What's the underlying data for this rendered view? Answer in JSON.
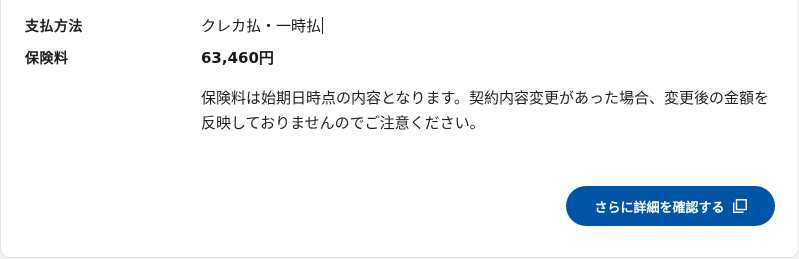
{
  "rows": {
    "payment_method": {
      "label": "支払方法",
      "value": "クレカ払・一時払"
    },
    "premium": {
      "label": "保険料",
      "value": "63,460円"
    }
  },
  "note": "保険料は始期日時点の内容となります。契約内容変更があった場合、変更後の金額を反映しておりませんのでご注意ください。",
  "details_button": {
    "label": "さらに詳細を確認する",
    "icon": "external-window-icon"
  },
  "colors": {
    "button_bg": "#0054a8",
    "button_text": "#ffffff"
  }
}
